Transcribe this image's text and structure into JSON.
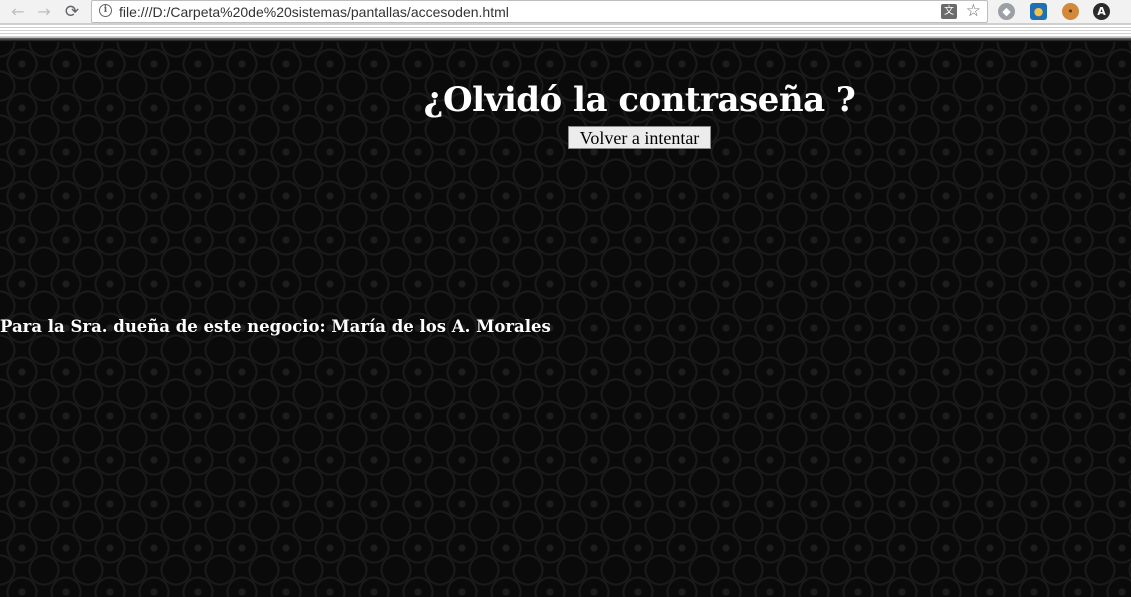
{
  "browser": {
    "url": "file:///D:/Carpeta%20de%20sistemas/pantallas/accesoden.html",
    "nav": {
      "back_icon": "arrow-left",
      "forward_icon": "arrow-right",
      "reload_icon": "reload"
    },
    "extensions": [
      "extension-gray",
      "extension-spy",
      "extension-cookie",
      "extension-a"
    ]
  },
  "page": {
    "heading": "¿Olvidó la contraseña ?",
    "retry_button": "Volver a intentar",
    "owner_note": "Para la Sra. dueña de este negocio: María de los A. Morales"
  },
  "colors": {
    "page_background": "#0a0a0a",
    "text": "#ffffff",
    "button_background": "#ececec"
  }
}
